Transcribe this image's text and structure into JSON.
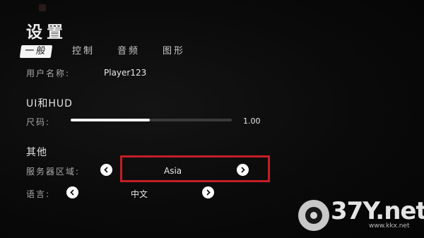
{
  "title": "设置",
  "tabs": [
    {
      "label": "一般",
      "active": true
    },
    {
      "label": "控制",
      "active": false
    },
    {
      "label": "音频",
      "active": false
    },
    {
      "label": "图形",
      "active": false
    }
  ],
  "username": {
    "label": "用户名称:",
    "value": "Player123"
  },
  "ui_hud": {
    "heading": "UI和HUD",
    "size_label": "尺码:",
    "size_value_text": "1.00",
    "size_fill_fraction": 0.49
  },
  "other": {
    "heading": "其他",
    "server_region": {
      "label": "服务器区域:",
      "value": "Asia"
    },
    "language": {
      "label": "语言:",
      "value": "中文"
    }
  },
  "watermark": {
    "text": "37Y.net",
    "sub": "www.kkx.net"
  },
  "colors": {
    "highlight": "#c41e25",
    "accent": "#f2f2f2"
  },
  "icons": {
    "prev": "chevron-left-icon",
    "next": "chevron-right-icon"
  }
}
